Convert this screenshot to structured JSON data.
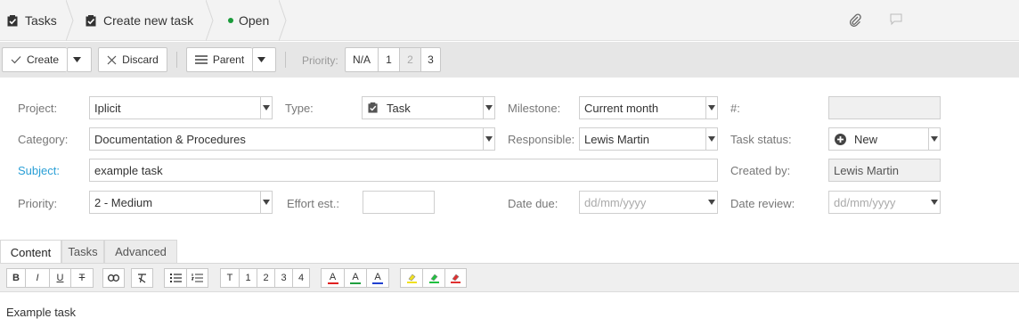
{
  "header": {
    "crumbs": [
      "Tasks",
      "Create new task",
      "Open"
    ],
    "icons": [
      "checkbox-task-icon",
      "checkbox-task-icon",
      "status-dot-icon",
      "paperclip-icon",
      "comment-icon"
    ],
    "status_color": "#1a9b3a"
  },
  "toolbar": {
    "create_label": "Create",
    "discard_label": "Discard",
    "parent_label": "Parent",
    "priority_label": "Priority:",
    "priority_options": [
      "N/A",
      "1",
      "2",
      "3"
    ]
  },
  "form": {
    "project_label": "Project:",
    "project_value": "Iplicit",
    "type_label": "Type:",
    "type_value": "Task",
    "milestone_label": "Milestone:",
    "milestone_value": "Current month",
    "number_label": "#:",
    "category_label": "Category:",
    "category_value": "Documentation & Procedures",
    "responsible_label": "Responsible:",
    "responsible_value": "Lewis Martin",
    "task_status_label": "Task status:",
    "task_status_value": "New",
    "subject_label": "Subject:",
    "subject_value": "example task",
    "created_by_label": "Created by:",
    "created_by_value": "Lewis Martin",
    "priority_label": "Priority:",
    "priority_value": "2 - Medium",
    "effort_label": "Effort est.:",
    "date_due_label": "Date due:",
    "date_due_placeholder": "dd/mm/yyyy",
    "date_review_label": "Date review:",
    "date_review_placeholder": "dd/mm/yyyy",
    "subject_color": "#2a9fd6"
  },
  "tabs": [
    "Content",
    "Tasks",
    "Advanced"
  ],
  "editor": {
    "bold": "B",
    "italic": "I",
    "underline": "U",
    "strike": "T",
    "heading_buttons": [
      "T",
      "1",
      "2",
      "3",
      "4"
    ],
    "text_color_glyph": "A",
    "content": "Example task",
    "text_colors": [
      "#e02020",
      "#20a040",
      "#2040d0"
    ],
    "highlight_colors": [
      "#f0e020",
      "#20c040",
      "#e03030"
    ]
  }
}
